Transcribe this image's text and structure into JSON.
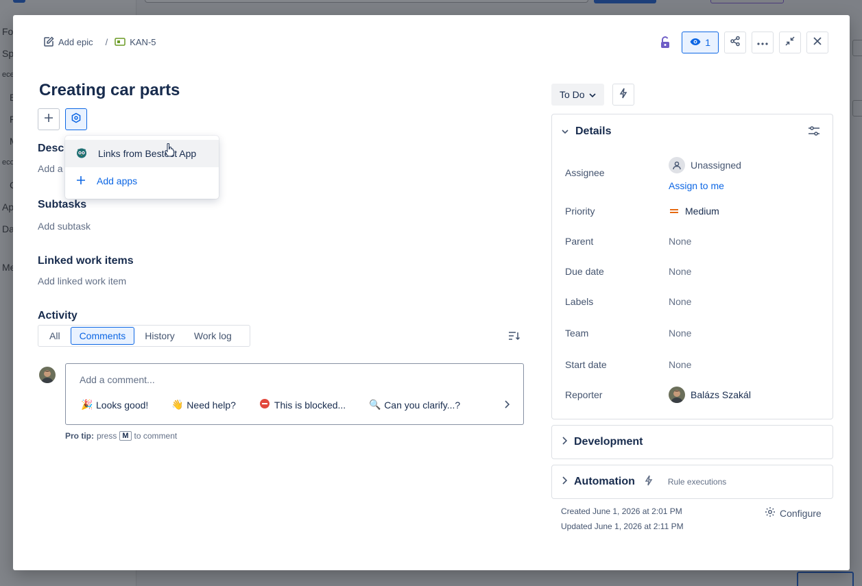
{
  "background": {
    "sidebar_fragments": [
      "Fo",
      "Sp",
      "ece",
      "E",
      "P",
      "M",
      "eco",
      "C",
      "Ap",
      "Da",
      "Me"
    ]
  },
  "breadcrumb": {
    "epic_label": "Add epic",
    "issue_key": "KAN-5"
  },
  "header_actions": {
    "watch_count": "1"
  },
  "issue": {
    "title": "Creating car parts"
  },
  "apps_dropdown": {
    "items": [
      {
        "label": "Links from Bestest App",
        "icon": "owl-app-icon"
      },
      {
        "label": "Add apps",
        "icon": "plus-icon"
      }
    ]
  },
  "sections": {
    "description_label": "Desc",
    "description_placeholder": "Add a",
    "subtasks_label": "Subtasks",
    "subtasks_placeholder": "Add subtask",
    "linked_label": "Linked work items",
    "linked_placeholder": "Add linked work item",
    "activity_label": "Activity"
  },
  "activity": {
    "tabs": [
      "All",
      "Comments",
      "History",
      "Work log"
    ],
    "active_tab": "Comments",
    "comment_placeholder": "Add a comment...",
    "quick_replies": [
      {
        "emoji": "🎉",
        "label": "Looks good!"
      },
      {
        "emoji": "👋",
        "label": "Need help?"
      },
      {
        "emoji": "⛔",
        "label": "This is blocked..."
      },
      {
        "emoji": "🔍",
        "label": "Can you clarify...?"
      }
    ],
    "protip_bold": "Pro tip:",
    "protip_press": "press",
    "protip_key": "M",
    "protip_rest": "to comment"
  },
  "status": {
    "label": "To Do"
  },
  "details": {
    "heading": "Details",
    "fields": [
      {
        "label": "Assignee",
        "value": "Unassigned"
      },
      {
        "label": "Priority",
        "value": "Medium"
      },
      {
        "label": "Parent",
        "value": "None"
      },
      {
        "label": "Due date",
        "value": "None"
      },
      {
        "label": "Labels",
        "value": "None"
      },
      {
        "label": "Team",
        "value": "None"
      },
      {
        "label": "Start date",
        "value": "None"
      },
      {
        "label": "Reporter",
        "value": "Balázs Szakál"
      }
    ],
    "assign_to_me": "Assign to me"
  },
  "development": {
    "heading": "Development"
  },
  "automation": {
    "heading": "Automation",
    "sub": "Rule executions"
  },
  "meta": {
    "created": "Created June 1, 2026 at 2:01 PM",
    "updated": "Updated June 1, 2026 at 2:11 PM",
    "configure": "Configure"
  },
  "colors": {
    "accent": "#0c66e4",
    "priority_medium": "#e56910",
    "lock": "#6e5dc6"
  }
}
